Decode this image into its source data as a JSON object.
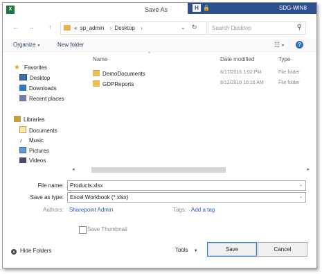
{
  "window": {
    "app_icon_text": "X",
    "title": "Save As",
    "remote_tab_letter": "H",
    "remote_lock": "🔒",
    "remote_host": "SDG-WIN8"
  },
  "nav": {
    "back": "←",
    "forward": "→",
    "up": "↑",
    "address_prefix": "«",
    "breadcrumbs": [
      "sp_admin",
      "Desktop"
    ],
    "crumb_separator": "›",
    "address_dropdown": "⌄",
    "refresh": "↻",
    "search_placeholder": "Search Desktop",
    "search_icon": "⚲"
  },
  "toolbar": {
    "organize": "Organize",
    "organize_dd": "▾",
    "new_folder": "New folder",
    "view_icon": "☷",
    "view_dd": "▾",
    "help": "?"
  },
  "navpane": {
    "favorites_label": "Favorites",
    "favorites": [
      "Desktop",
      "Downloads",
      "Recent places"
    ],
    "libraries_label": "Libraries",
    "libraries": [
      "Documents",
      "Music",
      "Pictures",
      "Videos"
    ]
  },
  "filelist": {
    "columns": {
      "name": "Name",
      "date": "Date modified",
      "type": "Type"
    },
    "sort_arrow": "^",
    "rows": [
      {
        "name": "DemoDocuments",
        "date": "8/17/2016 1:02 PM",
        "type": "File folder"
      },
      {
        "name": "GDPReports",
        "date": "8/12/2016 10:16 AM",
        "type": "File folder"
      }
    ],
    "scroll_left": "◂",
    "scroll_right": "▸"
  },
  "form": {
    "filename_label": "File name:",
    "filename_value": "Products.xlsx",
    "savetype_label": "Save as type:",
    "savetype_value": "Excel Workbook (*.xlsx)",
    "dropdown_caret": "⌄",
    "authors_label": "Authors:",
    "authors_value": "Sharepoint Admin",
    "tags_label": "Tags:",
    "tags_value": "Add a tag",
    "thumbnail_label": "Save Thumbnail"
  },
  "footer": {
    "hide_folders_icon": "▲",
    "hide_folders": "Hide Folders",
    "tools": "Tools",
    "tools_dd": "▼",
    "save": "Save",
    "cancel": "Cancel"
  },
  "colors": {
    "accent_blue": "#2c4f8e",
    "link_blue": "#2a5db0",
    "excel_green": "#1f7244",
    "folder_yellow": "#e8bf55"
  }
}
